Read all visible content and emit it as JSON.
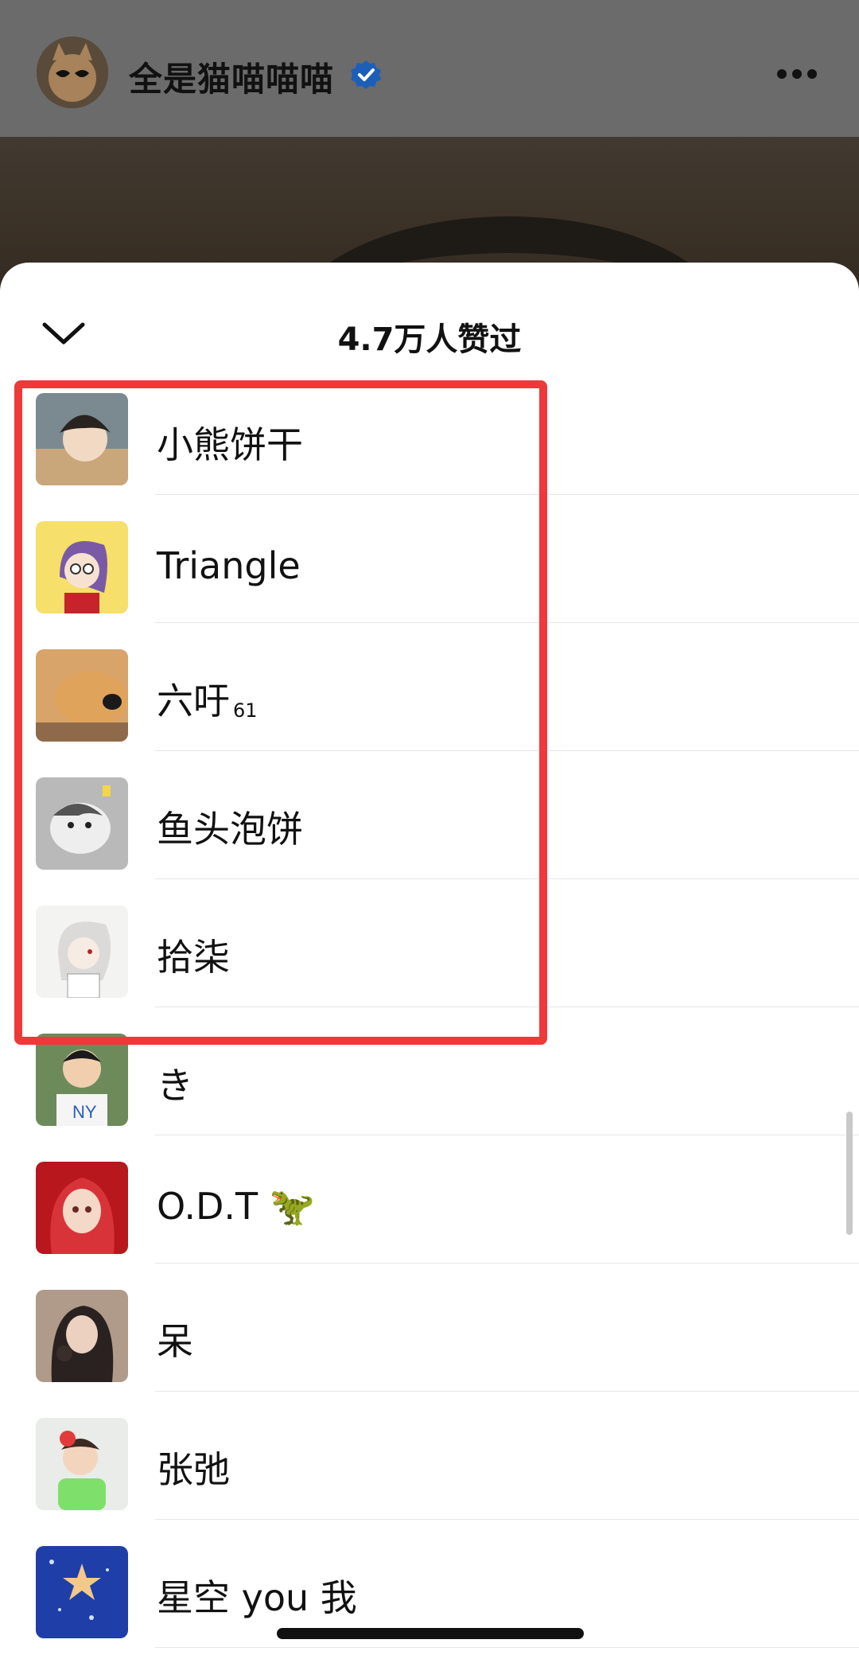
{
  "header": {
    "account_name": "全是猫喵喵喵",
    "verified_icon": "verified-badge-icon",
    "more_icon": "more-horizontal-icon"
  },
  "sheet": {
    "title": "4.7万人赞过",
    "collapse_icon": "chevron-down-icon"
  },
  "likers": [
    {
      "name": "小熊饼干",
      "suffix": ""
    },
    {
      "name": "Triangle",
      "suffix": ""
    },
    {
      "name": "六吁",
      "suffix": "61"
    },
    {
      "name": "鱼头泡饼",
      "suffix": ""
    },
    {
      "name": "拾柒",
      "suffix": ""
    },
    {
      "name": "き",
      "suffix": ""
    },
    {
      "name": "O.D.T 🦖",
      "suffix": ""
    },
    {
      "name": "呆",
      "suffix": ""
    },
    {
      "name": "张弛",
      "suffix": ""
    },
    {
      "name": "星空 you 我",
      "suffix": ""
    }
  ],
  "colors": {
    "highlight_border": "#f0383b",
    "verified_blue": "#1d6fe0"
  }
}
